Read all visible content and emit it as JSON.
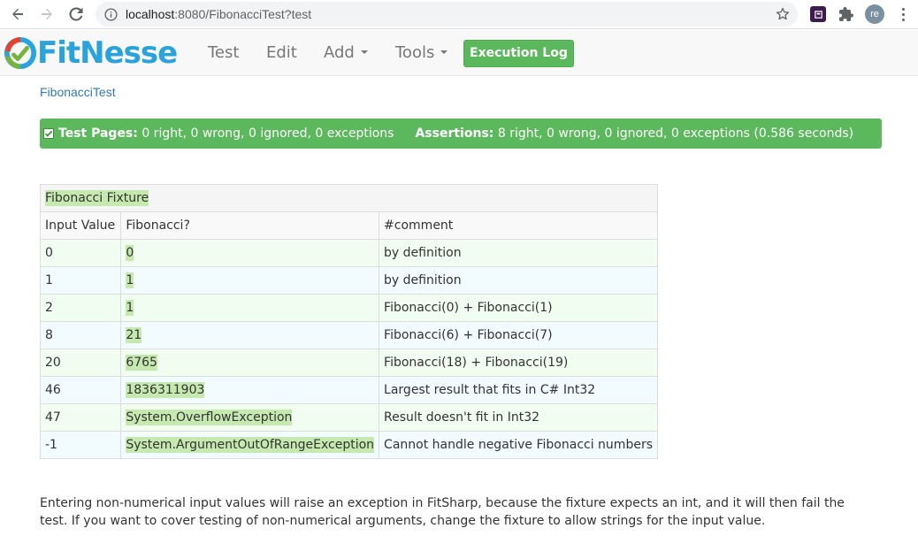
{
  "browser": {
    "url_host": "localhost",
    "url_rest": ":8080/FibonacciTest?test",
    "avatar_initials": "re",
    "icons": [
      "back-arrow-icon",
      "forward-arrow-icon",
      "reload-icon",
      "info-icon",
      "star-icon",
      "extension-icon",
      "puzzle-icon",
      "kebab-menu-icon"
    ]
  },
  "header": {
    "logo_text": "FitNesse",
    "menu": {
      "test": "Test",
      "edit": "Edit",
      "add": "Add",
      "tools": "Tools"
    },
    "execution_log": "Execution Log"
  },
  "breadcrumb": "FibonacciTest",
  "summary": {
    "test_pages_label": "Test Pages:",
    "test_pages_value": "0 right, 0 wrong, 0 ignored, 0 exceptions",
    "assertions_label": "Assertions:",
    "assertions_value": "8 right, 0 wrong, 0 ignored, 0 exceptions (0.586 seconds)",
    "color": "#5cb85c"
  },
  "table": {
    "title": "Fibonacci Fixture",
    "headers": [
      "Input Value",
      "Fibonacci?",
      "#comment"
    ],
    "rows": [
      {
        "input": "0",
        "result": "0",
        "comment": "by definition"
      },
      {
        "input": "1",
        "result": "1",
        "comment": "by definition"
      },
      {
        "input": "2",
        "result": "1",
        "comment": "Fibonacci(0) + Fibonacci(1)"
      },
      {
        "input": "8",
        "result": "21",
        "comment": "Fibonacci(6) + Fibonacci(7)"
      },
      {
        "input": "20",
        "result": "6765",
        "comment": "Fibonacci(18) + Fibonacci(19)"
      },
      {
        "input": "46",
        "result": "1836311903",
        "comment": "Largest result that fits in C# Int32"
      },
      {
        "input": "47",
        "result": "System.OverflowException",
        "comment": "Result doesn't fit in Int32"
      },
      {
        "input": "-1",
        "result": "System.ArgumentOutOfRangeException",
        "comment": "Cannot handle negative Fibonacci numbers"
      }
    ],
    "pass_color": "#c6e9b0"
  },
  "paragraph": "Entering non-numerical input values will raise an exception in FitSharp, because the fixture expects an int, and it will then fail the test. If you want to cover testing of non-numerical arguments, change the fixture to allow strings for the input value."
}
